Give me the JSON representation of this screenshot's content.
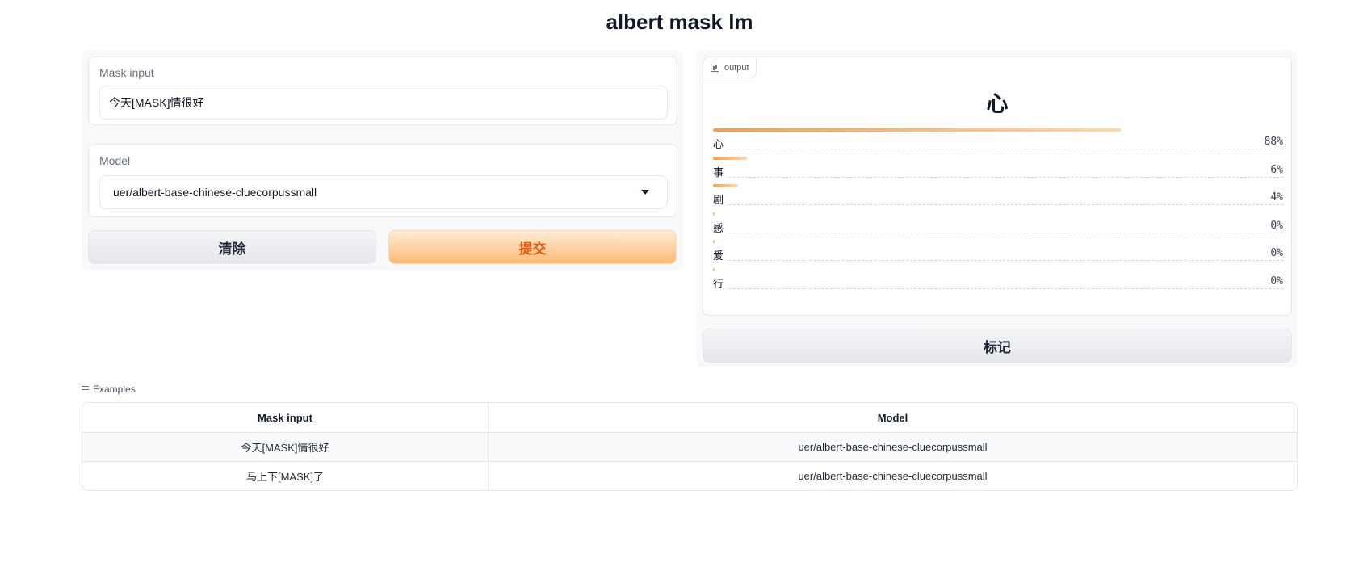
{
  "app": {
    "title": "albert mask lm"
  },
  "inputs": {
    "mask_label": "Mask input",
    "mask_value": "今天[MASK]情很好",
    "model_label": "Model",
    "model_value": "uer/albert-base-chinese-cluecorpussmall",
    "clear_label": "清除",
    "submit_label": "提交"
  },
  "output": {
    "tag_label": "output",
    "top_label": "心",
    "confidences": [
      {
        "label": "心",
        "value": 0.88,
        "text": "88%"
      },
      {
        "label": "事",
        "value": 0.06,
        "text": "6%"
      },
      {
        "label": "剧",
        "value": 0.04,
        "text": "4%"
      },
      {
        "label": "感",
        "value": 0.0,
        "text": "0%"
      },
      {
        "label": "爱",
        "value": 0.0,
        "text": "0%"
      },
      {
        "label": "行",
        "value": 0.0,
        "text": "0%"
      }
    ],
    "flag_label": "标记"
  },
  "examples": {
    "title": "Examples",
    "headers": [
      "Mask input",
      "Model"
    ],
    "rows": [
      [
        "今天[MASK]情很好",
        "uer/albert-base-chinese-cluecorpussmall"
      ],
      [
        "马上下[MASK]了",
        "uer/albert-base-chinese-cluecorpussmall"
      ]
    ]
  },
  "colors": {
    "accent": "#ea580c",
    "bar_start": "#f59e4a",
    "bar_end": "#fed7aa"
  },
  "icons": {
    "output_tag": "bar-chart-icon",
    "dropdown": "chevron-down-icon",
    "examples": "list-icon"
  }
}
